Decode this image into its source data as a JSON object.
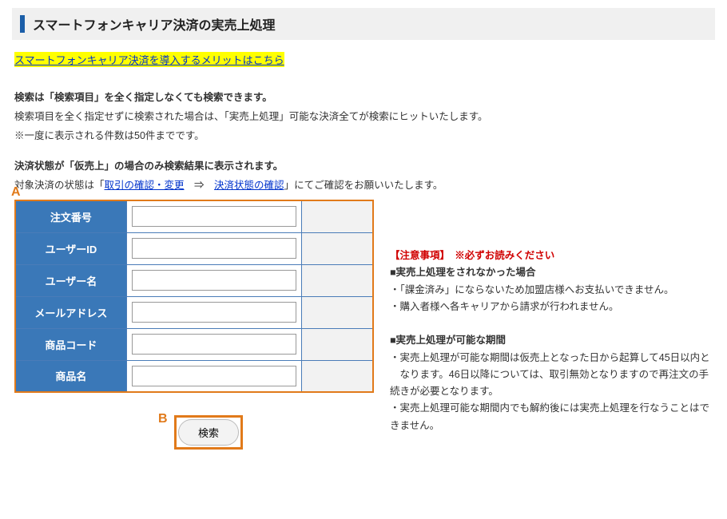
{
  "header": {
    "title": "スマートフォンキャリア決済の実売上処理"
  },
  "intro": {
    "highlight_link": "スマートフォンキャリア決済を導入するメリットはこちら",
    "p1_bold": "検索は「検索項目」を全く指定しなくても検索できます。",
    "p2": "検索項目を全く指定せずに検索された場合は、「実売上処理」可能な決済全てが検索にヒットいたします。",
    "p3": "※一度に表示される件数は50件までです。",
    "p4_bold": "決済状態が「仮売上」の場合のみ検索結果に表示されます。",
    "p5_prefix": "対象決済の状態は「",
    "p5_link1": "取引の確認・変更",
    "p5_arrow": "　⇒　",
    "p5_link2": "決済状態の確認",
    "p5_suffix": "」にてご確認をお願いいたします。"
  },
  "markers": {
    "a": "A",
    "b": "B"
  },
  "form": {
    "rows": [
      {
        "label": "注文番号",
        "value": ""
      },
      {
        "label": "ユーザーID",
        "value": ""
      },
      {
        "label": "ユーザー名",
        "value": ""
      },
      {
        "label": "メールアドレス",
        "value": ""
      },
      {
        "label": "商品コード",
        "value": ""
      },
      {
        "label": "商品名",
        "value": ""
      }
    ],
    "search_label": "検索"
  },
  "notes": {
    "caution_label": "【注意事項】",
    "caution_read": "※必ずお読みください",
    "h1": "■実売上処理をされなかった場合",
    "h1_line1": "・「課金済み」にならないため加盟店様へお支払いできません。",
    "h1_line2": "・購入者様へ各キャリアから請求が行われません。",
    "h2": "■実売上処理が可能な期間",
    "h2_line1": "・実売上処理が可能な期間は仮売上となった日から起算して45日以内と",
    "h2_line2": "　なります。46日以降については、取引無効となりますので再注文の手続きが必要となります。",
    "h2_line3": "・実売上処理可能な期間内でも解約後には実売上処理を行なうことはできません。"
  }
}
